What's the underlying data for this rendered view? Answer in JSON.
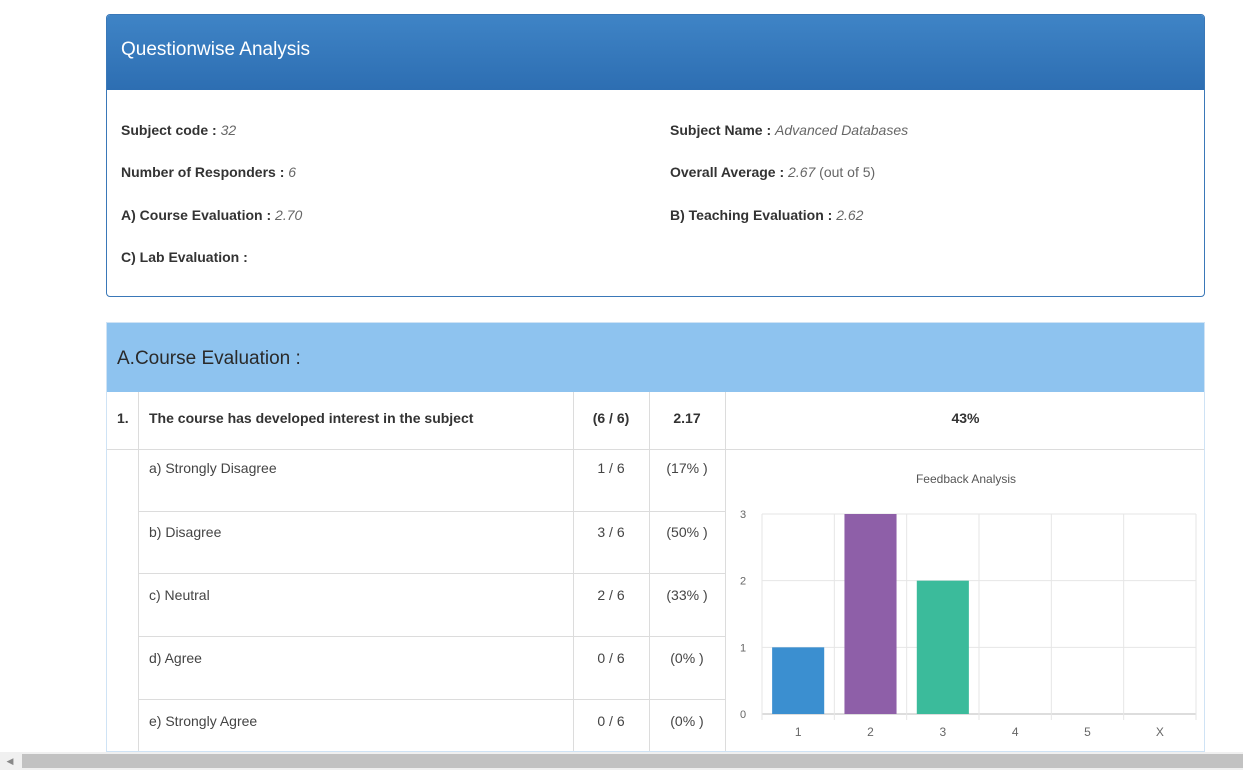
{
  "analysis": {
    "title": "Questionwise Analysis",
    "subject_code_label": "Subject code :",
    "subject_code": "32",
    "subject_name_label": "Subject Name :",
    "subject_name": "Advanced Databases",
    "responders_label": "Number of Responders :",
    "responders": "6",
    "overall_label": "Overall Average :",
    "overall_value": "2.67",
    "overall_suffix": "(out of 5)",
    "course_eval_label": "A) Course Evaluation :",
    "course_eval_value": "2.70",
    "teaching_eval_label": "B) Teaching Evaluation :",
    "teaching_eval_value": "2.62",
    "lab_eval_label": "C) Lab Evaluation :"
  },
  "course_section": {
    "title": "A.Course Evaluation :",
    "question": {
      "number": "1.",
      "text": "The course has developed interest in the subject",
      "responses": "(6 / 6)",
      "average": "2.17",
      "percent": "43%"
    },
    "options": [
      {
        "label": "a) Strongly Disagree",
        "count": "1 / 6",
        "percent": "(17% )"
      },
      {
        "label": "b) Disagree",
        "count": "3 / 6",
        "percent": "(50% )"
      },
      {
        "label": "c) Neutral",
        "count": "2 / 6",
        "percent": "(33% )"
      },
      {
        "label": "d) Agree",
        "count": "0 / 6",
        "percent": "(0% )"
      },
      {
        "label": "e) Strongly Agree",
        "count": "0 / 6",
        "percent": "(0% )"
      }
    ]
  },
  "chart_data": {
    "type": "bar",
    "title": "Feedback Analysis",
    "categories": [
      "1",
      "2",
      "3",
      "4",
      "5",
      "X"
    ],
    "values": [
      1,
      3,
      2,
      0,
      0,
      0
    ],
    "colors": [
      "#3b8fd0",
      "#8e5fa8",
      "#3bbb9b",
      "#cccccc",
      "#cccccc",
      "#cccccc"
    ],
    "yticks": [
      "0",
      "1",
      "2",
      "3"
    ],
    "ylim": [
      0,
      3
    ],
    "grid": true,
    "legend": "none"
  }
}
